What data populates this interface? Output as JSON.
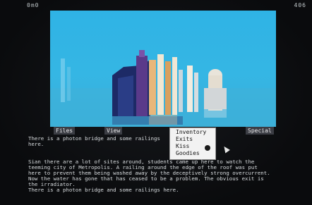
{
  "status": {
    "left": "0m0",
    "right": "406"
  },
  "menu": {
    "items": [
      "Files",
      "View",
      "Special"
    ]
  },
  "dropdown": {
    "items": [
      "Inventory",
      "Exits",
      "Kiss",
      "Goodies"
    ]
  },
  "text": {
    "lines": [
      "There is a photon bridge and some railings",
      "here.",
      "",
      "Sian there are a lot of sites around, students came up here to watch the",
      "teeming city of Metropolis. A railing around the edge of the roof was put",
      "here to prevent them being washed away by the deceptively strong overcurrent.",
      "Now the water has gone that has ceased to be a problem. The obvious exit is",
      "the irradiator.",
      "There is a photon bridge and some railings here."
    ]
  },
  "colors": {
    "sky": "#35b6e4",
    "building_dark": "#1d2a66",
    "building_light": "#ece6d6",
    "menu_bg": "#3b3d44",
    "dropdown_bg": "#f2f2f2"
  }
}
